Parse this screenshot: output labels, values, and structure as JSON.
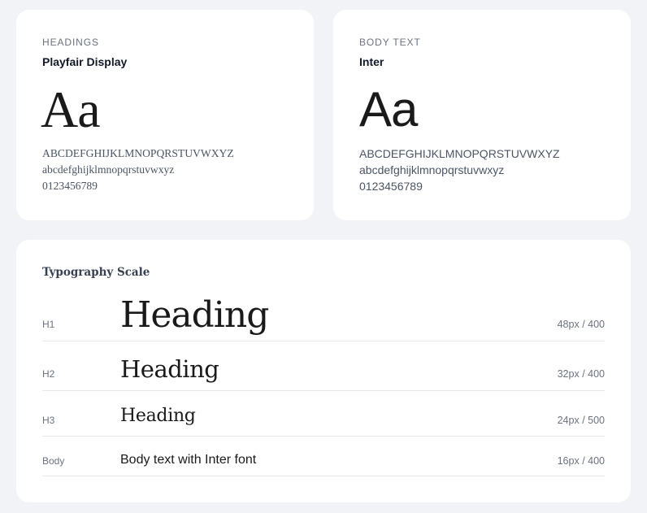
{
  "headings_card": {
    "eyebrow": "HEADINGS",
    "font_name": "Playfair Display",
    "sample": "Aa",
    "uppercase": "ABCDEFGHIJKLMNOPQRSTUVWXYZ",
    "lowercase": "abcdefghijklmnopqrstuvwxyz",
    "digits": "0123456789"
  },
  "body_card": {
    "eyebrow": "BODY TEXT",
    "font_name": "Inter",
    "sample": "Aa",
    "uppercase": "ABCDEFGHIJKLMNOPQRSTUVWXYZ",
    "lowercase": "abcdefghijklmnopqrstuvwxyz",
    "digits": "0123456789"
  },
  "scale": {
    "title": "Typography Scale",
    "rows": [
      {
        "tag": "H1",
        "sample": "Heading",
        "spec": "48px / 400"
      },
      {
        "tag": "H2",
        "sample": "Heading",
        "spec": "32px / 400"
      },
      {
        "tag": "H3",
        "sample": "Heading",
        "spec": "24px / 500"
      },
      {
        "tag": "Body",
        "sample": "Body text with Inter font",
        "spec": "16px / 400"
      }
    ]
  },
  "colors": {
    "page_background": "#f1f3f6",
    "card_background": "#ffffff",
    "text_primary": "#111827",
    "text_muted": "#6b7280",
    "divider": "#e5e7eb"
  }
}
